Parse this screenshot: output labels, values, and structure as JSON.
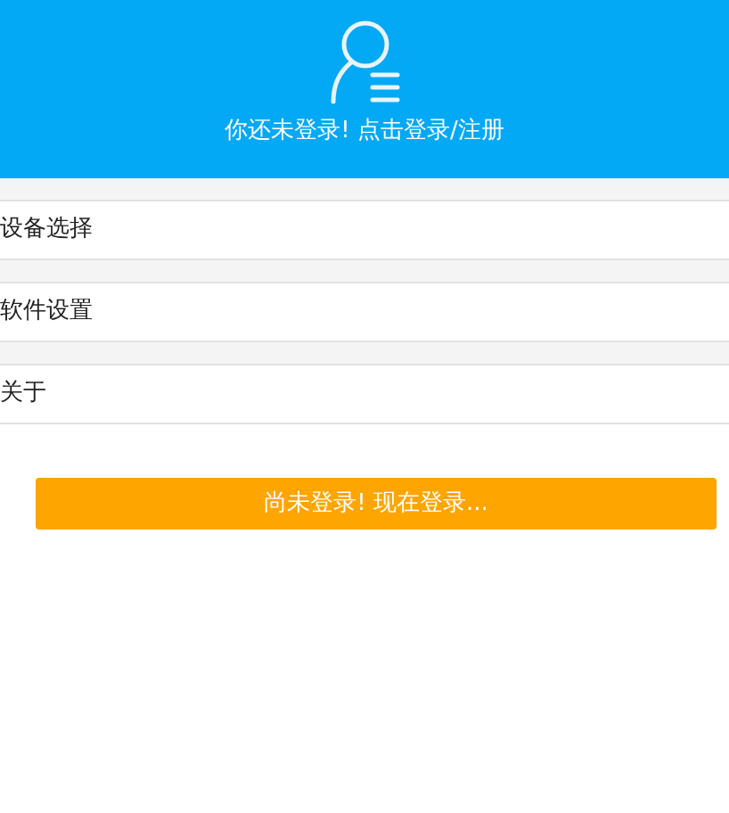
{
  "header": {
    "login_prompt": "你还未登录! 点击登录/注册"
  },
  "menu": [
    {
      "label": "设备选择"
    },
    {
      "label": "软件设置"
    },
    {
      "label": "关于"
    }
  ],
  "login_button": "尚未登录! 现在登录..."
}
